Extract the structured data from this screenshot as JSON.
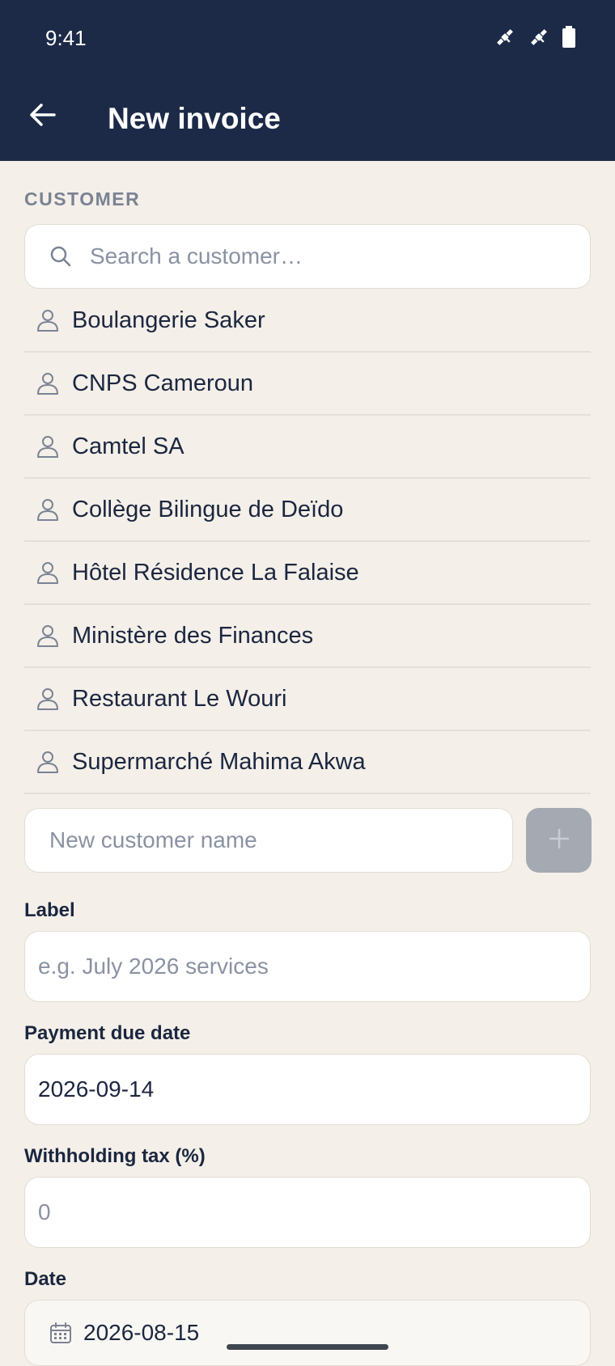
{
  "status_bar": {
    "time": "9:41",
    "icons": [
      "satellite-icon",
      "satellite-icon",
      "battery-icon"
    ]
  },
  "header": {
    "back_icon": "arrow-left-icon",
    "title": "New invoice"
  },
  "customer_section": {
    "label": "CUSTOMER",
    "search": {
      "placeholder": "Search a customer…",
      "value": "",
      "icon": "search-icon"
    },
    "customers": [
      "Boulangerie Saker",
      "CNPS Cameroun",
      "Camtel SA",
      "Collège Bilingue de Deïdo",
      "Hôtel Résidence La Falaise",
      "Ministère des Finances",
      "Restaurant Le Wouri",
      "Supermarché Mahima Akwa"
    ],
    "new_customer": {
      "placeholder": "New customer name",
      "value": ""
    },
    "add_button_icon": "plus-icon"
  },
  "form": {
    "label_field": {
      "label": "Label",
      "placeholder": "e.g. July 2026 services",
      "value": ""
    },
    "due_date": {
      "label": "Payment due date",
      "value": "2026-09-14"
    },
    "withholding_tax": {
      "label": "Withholding tax (%)",
      "placeholder": "0",
      "value": ""
    },
    "date": {
      "label": "Date",
      "value": "2026-08-15",
      "icon": "calendar-icon"
    }
  },
  "colors": {
    "appbar": "#1c2a48",
    "background": "#f4efe8",
    "text": "#1b2640",
    "muted": "#8a92a2",
    "add_button_disabled": "#a5a9b1"
  }
}
